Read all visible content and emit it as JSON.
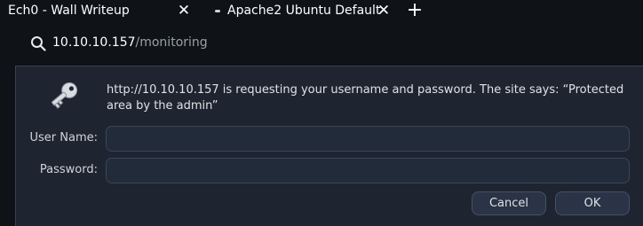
{
  "tabs": [
    {
      "title": "Ech0 - Wall Writeup",
      "close": "✕"
    },
    {
      "title": "Apache2 Ubuntu Default",
      "close": "✕"
    }
  ],
  "new_tab_label": "+",
  "url": {
    "host": "10.10.10.157",
    "path": "/monitoring"
  },
  "auth_dialog": {
    "message": "http://10.10.10.157 is requesting your username and password. The site says: “Protected area by the admin”",
    "username_label": "User Name:",
    "username_value": "",
    "password_label": "Password:",
    "password_value": "",
    "cancel_label": "Cancel",
    "ok_label": "OK"
  },
  "icons": {
    "search": "search-icon",
    "key": "key-icon"
  },
  "colors": {
    "background": "#0f1216",
    "dialog": "#1f2530",
    "field": "#222b3a",
    "button": "#2a3446"
  }
}
